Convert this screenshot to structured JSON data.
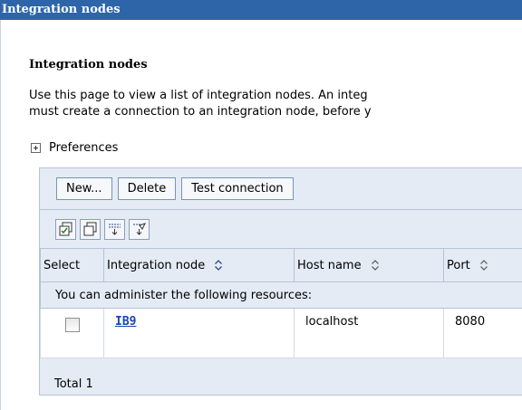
{
  "titlebar": {
    "title": "Integration nodes"
  },
  "section": {
    "title": "Integration nodes"
  },
  "description": {
    "line1": "Use this page to view a list of integration nodes. An integ",
    "line2": "must create a connection to an integration node, before y"
  },
  "preferences": {
    "label": "Preferences"
  },
  "buttons": {
    "new": "New...",
    "delete": "Delete",
    "test": "Test connection"
  },
  "toolbar_icons": [
    "select-all-icon",
    "deselect-all-icon",
    "show-filter-icon",
    "clear-filter-icon"
  ],
  "table": {
    "columns": [
      "Select",
      "Integration node",
      "Host name",
      "Port"
    ],
    "group_label": "You can administer the following resources:",
    "rows": [
      {
        "selected": false,
        "node": "IB9",
        "host": "localhost",
        "port": "8080"
      }
    ],
    "total": "Total 1"
  },
  "colors": {
    "titlebar": "#2e65a8",
    "panel": "#e4ebf5",
    "link": "#1a43b5"
  }
}
